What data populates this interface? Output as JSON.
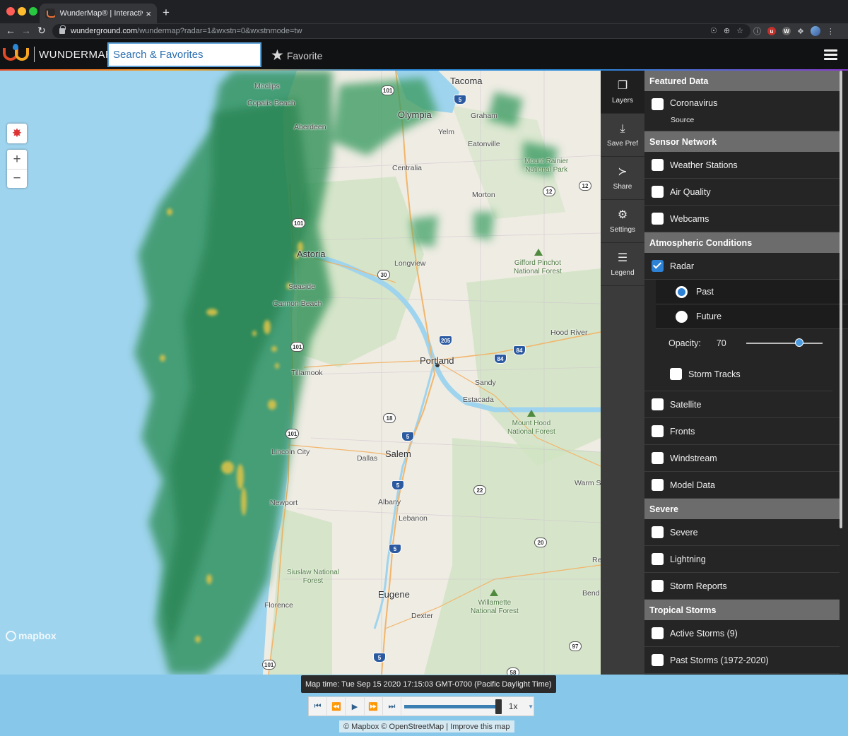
{
  "browser": {
    "tab_title": "WunderMap® | Interactive Wea",
    "tab_close": "×",
    "new_tab": "+",
    "url_host": "wunderground.com",
    "url_path": "/wundermap?radar=1&wxstn=0&wxstnmode=tw"
  },
  "header": {
    "logo_text": "WUNDERMAP",
    "search_placeholder": "Search & Favorites",
    "favorite_label": "Favorite"
  },
  "map": {
    "labels": {
      "moclips": "Moclips",
      "copalis": "Copalis Beach",
      "aberdeen": "Aberdeen",
      "tacoma": "Tacoma",
      "olympia": "Olympia",
      "graham": "Graham",
      "yelm": "Yelm",
      "eatonville": "Eatonville",
      "centralia": "Centralia",
      "rainier": "Mount Rainier\nNational Park",
      "morton": "Morton",
      "astoria": "Astoria",
      "longview": "Longview",
      "gifford": "Gifford Pinchot\nNational Forest",
      "seaside": "Seaside",
      "cannon": "Cannon Beach",
      "hood_river": "Hood River",
      "tillamook": "Tillamook",
      "portland": "Portland",
      "sandy": "Sandy",
      "estacada": "Estacada",
      "mount_hood": "Mount Hood\nNational Forest",
      "lincoln": "Lincoln City",
      "salem": "Salem",
      "dallas": "Dallas",
      "warm_springs": "Warm S",
      "newport": "Newport",
      "albany": "Albany",
      "lebanon": "Lebanon",
      "siuslaw": "Siuslaw National\nForest",
      "eugene": "Eugene",
      "willamette": "Willamette\nNational Forest",
      "florence": "Florence",
      "dexter": "Dexter",
      "bend": "Bend",
      "re": "Re"
    },
    "shields": [
      "101",
      "5",
      "12",
      "12",
      "101",
      "30",
      "205",
      "84",
      "84",
      "101",
      "18",
      "5",
      "101",
      "22",
      "5",
      "5",
      "20",
      "97",
      "5",
      "101",
      "58"
    ],
    "mapbox_label": "mapbox"
  },
  "player": {
    "map_time": "Map time: Tue Sep 15 2020 17:15:03 GMT-0700 (Pacific Daylight Time)",
    "speed": "1x",
    "progress": 1.0,
    "attribution": "© Mapbox © OpenStreetMap | Improve this map"
  },
  "rail": {
    "layers": "Layers",
    "save_pref": "Save Pref",
    "share": "Share",
    "settings": "Settings",
    "legend": "Legend"
  },
  "panel": {
    "featured_data": "Featured Data",
    "coronavirus": "Coronavirus",
    "source": "Source",
    "sensor_network": "Sensor Network",
    "weather_stations": "Weather Stations",
    "air_quality": "Air Quality",
    "webcams": "Webcams",
    "atmospheric": "Atmospheric Conditions",
    "radar": "Radar",
    "past": "Past",
    "future": "Future",
    "opacity_label": "Opacity:",
    "opacity_value": "70",
    "storm_tracks": "Storm Tracks",
    "satellite": "Satellite",
    "fronts": "Fronts",
    "windstream": "Windstream",
    "model_data": "Model Data",
    "severe_header": "Severe",
    "severe": "Severe",
    "lightning": "Lightning",
    "storm_reports": "Storm Reports",
    "tropical": "Tropical Storms",
    "active_storms": "Active Storms (9)",
    "past_storms": "Past Storms (1972-2020)"
  }
}
